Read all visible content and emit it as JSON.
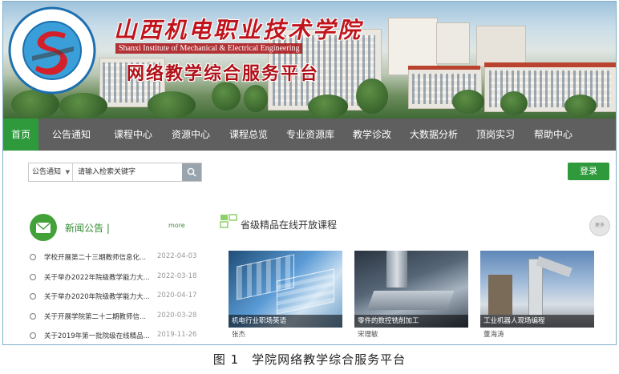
{
  "header": {
    "logo_ring_text": "山西机电职业技术学院",
    "logo_ring_text_en": "SHANXI INSTITUTE OF MECHANICAL & ELECTRICAL ENGINEERING",
    "college_name_cn": "山西机电职业技术学院",
    "college_name_en": "Shanxi Institute of Mechanical & Electrical Engineering",
    "platform_name": "网络教学综合服务平台"
  },
  "nav": {
    "items": [
      {
        "label": "首页",
        "active": true
      },
      {
        "label": "公告通知"
      },
      {
        "label": "课程中心"
      },
      {
        "label": "资源中心"
      },
      {
        "label": "课程总览"
      },
      {
        "label": "专业资源库"
      },
      {
        "label": "教学诊改"
      },
      {
        "label": "大数据分析"
      },
      {
        "label": "顶岗实习"
      },
      {
        "label": "帮助中心"
      }
    ]
  },
  "search": {
    "category": "公告通知",
    "placeholder": "请输入检索关键字",
    "icon": "search-icon"
  },
  "login": {
    "label": "登录"
  },
  "news": {
    "title": "新闻公告 |",
    "more": "more",
    "items": [
      {
        "title": "学校开展第二十三期教师信息化...",
        "date": "2022-04-03"
      },
      {
        "title": "关于举办2022年院级教学能力大...",
        "date": "2022-03-18"
      },
      {
        "title": "关于举办2020年院级教学能力大...",
        "date": "2020-04-17"
      },
      {
        "title": "关于开展学院第二十二期教师信...",
        "date": "2020-03-28"
      },
      {
        "title": "关于2019年第一批院级在线精品...",
        "date": "2019-11-26"
      }
    ]
  },
  "courses": {
    "title": "省级精品在线开放课程",
    "more": "更多",
    "items": [
      {
        "name": "机电行业职场英语",
        "teacher": "张杰"
      },
      {
        "name": "零件的数控铣削加工",
        "teacher": "宋理敏"
      },
      {
        "name": "工业机器人现场编程",
        "teacher": "董海涛"
      }
    ]
  },
  "figure_caption": "图 1　学院网络教学综合服务平台",
  "colors": {
    "accent_green": "#2e9a3c",
    "nav_bg": "#5f5f5f",
    "title_red": "#c0141c"
  }
}
